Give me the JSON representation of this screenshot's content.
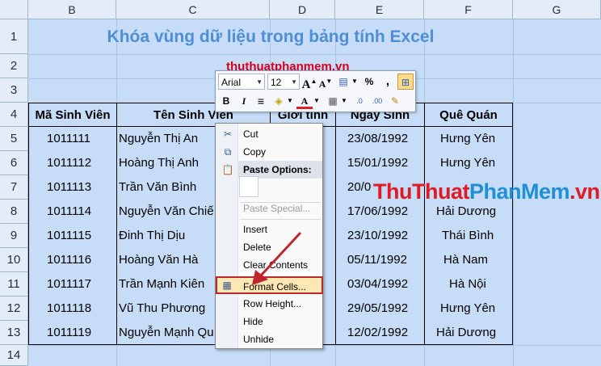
{
  "columns": [
    "B",
    "C",
    "D",
    "E",
    "F",
    "G"
  ],
  "rows": [
    "1",
    "2",
    "3",
    "4",
    "5",
    "6",
    "7",
    "8",
    "9",
    "10",
    "11",
    "12",
    "13",
    "14"
  ],
  "title": "Khóa vùng dữ liệu trong bảng tính Excel",
  "site_label": "thuthuatphanmem.vn",
  "watermark": {
    "part1": "ThuThuat",
    "part2": "PhanMem",
    "part3": ".vn"
  },
  "table": {
    "headers": [
      "Mã Sinh Viên",
      "Tên Sinh Viên",
      "Giới tính",
      "Ngày Sinh",
      "Quê Quán"
    ],
    "rows": [
      {
        "id": "1011111",
        "name": "Nguyễn Thị An",
        "date": "23/08/1992",
        "home": "Hưng Yên"
      },
      {
        "id": "1011112",
        "name": "Hoàng Thị Anh",
        "date": "15/01/1992",
        "home": "Hưng Yên"
      },
      {
        "id": "1011113",
        "name": "Trần Văn Bình",
        "date": "20/0",
        "home": ""
      },
      {
        "id": "1011114",
        "name": "Nguyễn Văn Chiế",
        "date": "17/06/1992",
        "home": "Hải Dương"
      },
      {
        "id": "1011115",
        "name": "Đinh Thị Dịu",
        "date": "23/10/1992",
        "home": "Thái Bình"
      },
      {
        "id": "1011116",
        "name": "Hoàng Văn Hà",
        "date": "05/11/1992",
        "home": "Hà Nam"
      },
      {
        "id": "1011117",
        "name": "Trần Mạnh Kiên",
        "date": "03/04/1992",
        "home": "Hà Nội"
      },
      {
        "id": "1011118",
        "name": "Vũ Thu Phương",
        "date": "29/05/1992",
        "home": "Hưng Yên"
      },
      {
        "id": "1011119",
        "name": "Nguyễn Mạnh Qu",
        "date": "12/02/1992",
        "home": "Hải Dương"
      }
    ]
  },
  "mini_toolbar": {
    "font": "Arial",
    "size": "12",
    "percent": "%",
    "comma": ",",
    "bold": "B",
    "italic": "I",
    "grow_font": "A",
    "shrink_font": "A",
    "font_color_letter": "A"
  },
  "context_menu": {
    "cut": "Cut",
    "copy": "Copy",
    "paste_options": "Paste Options:",
    "paste_special": "Paste Special...",
    "insert": "Insert",
    "delete": "Delete",
    "clear_contents": "Clear Contents",
    "format_cells": "Format Cells...",
    "row_height": "Row Height...",
    "hide": "Hide",
    "unhide": "Unhide"
  },
  "colors": {
    "sheet_fill": "#c6dcf7",
    "title_blue": "#4f8ed6",
    "site_red": "#d9001b",
    "highlight_border": "#c0272d",
    "arrow": "#c0272d"
  }
}
